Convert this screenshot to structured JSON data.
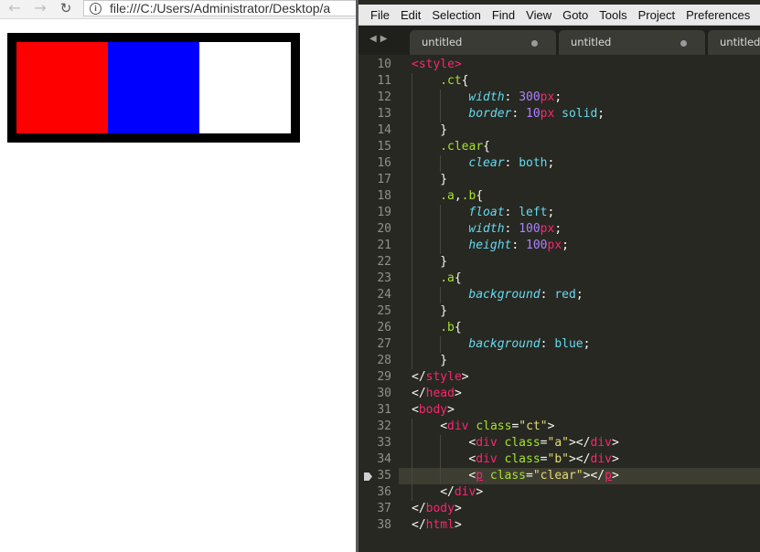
{
  "browser": {
    "url": "file:///C:/Users/Administrator/Desktop/a",
    "demo": {
      "box_a_color": "#ff0000",
      "box_b_color": "#0000ff",
      "border_color": "#000000"
    }
  },
  "editor": {
    "menu": [
      "File",
      "Edit",
      "Selection",
      "Find",
      "View",
      "Goto",
      "Tools",
      "Project",
      "Preferences"
    ],
    "tabs": [
      {
        "label": "untitled",
        "dirty": true
      },
      {
        "label": "untitled",
        "dirty": true
      },
      {
        "label": "untitled",
        "dirty": false
      }
    ],
    "current_line": 35,
    "lines": [
      {
        "n": 10,
        "indent": 0,
        "tokens": [
          [
            "tag",
            "<style>"
          ]
        ]
      },
      {
        "n": 11,
        "indent": 1,
        "tokens": [
          [
            "sel",
            ".ct"
          ],
          [
            "punc",
            "{"
          ]
        ]
      },
      {
        "n": 12,
        "indent": 2,
        "tokens": [
          [
            "prop",
            "width"
          ],
          [
            "punc",
            ": "
          ],
          [
            "num",
            "300"
          ],
          [
            "unit",
            "px"
          ],
          [
            "punc",
            ";"
          ]
        ]
      },
      {
        "n": 13,
        "indent": 2,
        "tokens": [
          [
            "prop",
            "border"
          ],
          [
            "punc",
            ": "
          ],
          [
            "num",
            "10"
          ],
          [
            "unit",
            "px"
          ],
          [
            "punc",
            " "
          ],
          [
            "val",
            "solid"
          ],
          [
            "punc",
            ";"
          ]
        ]
      },
      {
        "n": 14,
        "indent": 1,
        "tokens": [
          [
            "punc",
            "}"
          ]
        ]
      },
      {
        "n": 15,
        "indent": 1,
        "tokens": [
          [
            "sel",
            ".clear"
          ],
          [
            "punc",
            "{"
          ]
        ]
      },
      {
        "n": 16,
        "indent": 2,
        "tokens": [
          [
            "prop",
            "clear"
          ],
          [
            "punc",
            ": "
          ],
          [
            "val",
            "both"
          ],
          [
            "punc",
            ";"
          ]
        ]
      },
      {
        "n": 17,
        "indent": 1,
        "tokens": [
          [
            "punc",
            "}"
          ]
        ]
      },
      {
        "n": 18,
        "indent": 1,
        "tokens": [
          [
            "sel",
            ".a"
          ],
          [
            "punc",
            ","
          ],
          [
            "sel",
            ".b"
          ],
          [
            "punc",
            "{"
          ]
        ]
      },
      {
        "n": 19,
        "indent": 2,
        "tokens": [
          [
            "prop",
            "float"
          ],
          [
            "punc",
            ": "
          ],
          [
            "val",
            "left"
          ],
          [
            "punc",
            ";"
          ]
        ]
      },
      {
        "n": 20,
        "indent": 2,
        "tokens": [
          [
            "prop",
            "width"
          ],
          [
            "punc",
            ": "
          ],
          [
            "num",
            "100"
          ],
          [
            "unit",
            "px"
          ],
          [
            "punc",
            ";"
          ]
        ]
      },
      {
        "n": 21,
        "indent": 2,
        "tokens": [
          [
            "prop",
            "height"
          ],
          [
            "punc",
            ": "
          ],
          [
            "num",
            "100"
          ],
          [
            "unit",
            "px"
          ],
          [
            "punc",
            ";"
          ]
        ]
      },
      {
        "n": 22,
        "indent": 1,
        "tokens": [
          [
            "punc",
            "}"
          ]
        ]
      },
      {
        "n": 23,
        "indent": 1,
        "tokens": [
          [
            "sel",
            ".a"
          ],
          [
            "punc",
            "{"
          ]
        ]
      },
      {
        "n": 24,
        "indent": 2,
        "tokens": [
          [
            "prop",
            "background"
          ],
          [
            "punc",
            ": "
          ],
          [
            "val",
            "red"
          ],
          [
            "punc",
            ";"
          ]
        ]
      },
      {
        "n": 25,
        "indent": 1,
        "tokens": [
          [
            "punc",
            "}"
          ]
        ]
      },
      {
        "n": 26,
        "indent": 1,
        "tokens": [
          [
            "sel",
            ".b"
          ],
          [
            "punc",
            "{"
          ]
        ]
      },
      {
        "n": 27,
        "indent": 2,
        "tokens": [
          [
            "prop",
            "background"
          ],
          [
            "punc",
            ": "
          ],
          [
            "val",
            "blue"
          ],
          [
            "punc",
            ";"
          ]
        ]
      },
      {
        "n": 28,
        "indent": 1,
        "tokens": [
          [
            "punc",
            "}"
          ]
        ]
      },
      {
        "n": 29,
        "indent": 0,
        "tokens": [
          [
            "punc",
            "</"
          ],
          [
            "tag",
            "style"
          ],
          [
            "punc",
            ">"
          ]
        ]
      },
      {
        "n": 30,
        "indent": 0,
        "tokens": [
          [
            "punc",
            "</"
          ],
          [
            "tag",
            "head"
          ],
          [
            "punc",
            ">"
          ]
        ]
      },
      {
        "n": 31,
        "indent": 0,
        "tokens": [
          [
            "punc",
            "<"
          ],
          [
            "tag",
            "body"
          ],
          [
            "punc",
            ">"
          ]
        ]
      },
      {
        "n": 32,
        "indent": 1,
        "tokens": [
          [
            "punc",
            "<"
          ],
          [
            "tag",
            "div"
          ],
          [
            "punc",
            " "
          ],
          [
            "attr",
            "class"
          ],
          [
            "punc",
            "="
          ],
          [
            "str",
            "\"ct\""
          ],
          [
            "punc",
            ">"
          ]
        ]
      },
      {
        "n": 33,
        "indent": 2,
        "tokens": [
          [
            "punc",
            "<"
          ],
          [
            "tag",
            "div"
          ],
          [
            "punc",
            " "
          ],
          [
            "attr",
            "class"
          ],
          [
            "punc",
            "="
          ],
          [
            "str",
            "\"a\""
          ],
          [
            "punc",
            "></"
          ],
          [
            "tag",
            "div"
          ],
          [
            "punc",
            ">"
          ]
        ]
      },
      {
        "n": 34,
        "indent": 2,
        "tokens": [
          [
            "punc",
            "<"
          ],
          [
            "tag",
            "div"
          ],
          [
            "punc",
            " "
          ],
          [
            "attr",
            "class"
          ],
          [
            "punc",
            "="
          ],
          [
            "str",
            "\"b\""
          ],
          [
            "punc",
            "></"
          ],
          [
            "tag",
            "div"
          ],
          [
            "punc",
            ">"
          ]
        ]
      },
      {
        "n": 35,
        "indent": 2,
        "tokens": [
          [
            "punc",
            "<"
          ],
          [
            "tag ul",
            "p"
          ],
          [
            "punc",
            " "
          ],
          [
            "attr",
            "class"
          ],
          [
            "punc",
            "="
          ],
          [
            "str",
            "\"clear\""
          ],
          [
            "punc",
            "></"
          ],
          [
            "tag ul",
            "p"
          ],
          [
            "punc",
            ">"
          ]
        ]
      },
      {
        "n": 36,
        "indent": 1,
        "tokens": [
          [
            "punc",
            "</"
          ],
          [
            "tag",
            "div"
          ],
          [
            "punc",
            ">"
          ]
        ]
      },
      {
        "n": 37,
        "indent": 0,
        "tokens": [
          [
            "punc",
            "</"
          ],
          [
            "tag",
            "body"
          ],
          [
            "punc",
            ">"
          ]
        ]
      },
      {
        "n": 38,
        "indent": 0,
        "tokens": [
          [
            "punc",
            "</"
          ],
          [
            "tag",
            "html"
          ],
          [
            "punc",
            ">"
          ]
        ]
      }
    ]
  }
}
